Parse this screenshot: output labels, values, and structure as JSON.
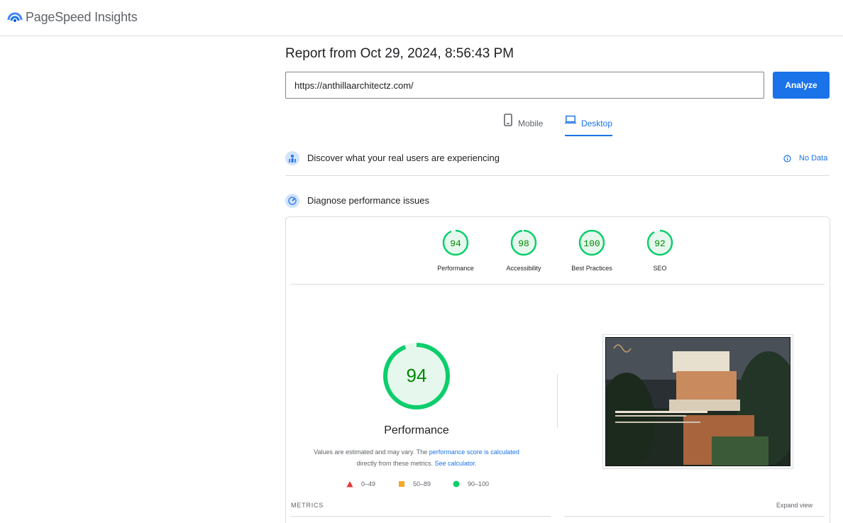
{
  "app": {
    "brand": "PageSpeed Insights"
  },
  "report": {
    "title": "Report from Oct 29, 2024, 8:56:43 PM"
  },
  "url_input": {
    "value": "https://anthillaarchitectz.com/"
  },
  "analyze_label": "Analyze",
  "tabs": [
    {
      "label": "Mobile",
      "icon": "phone-icon",
      "selected": false
    },
    {
      "label": "Desktop",
      "icon": "laptop-icon",
      "selected": true
    }
  ],
  "sections": {
    "real_users": {
      "title": "Discover what your real users are experiencing",
      "icon": "people-icon",
      "status": "No Data"
    },
    "diagnose": {
      "title": "Diagnose performance issues",
      "icon": "gauge-icon"
    }
  },
  "scores": [
    {
      "label": "Performance",
      "value": 94
    },
    {
      "label": "Accessibility",
      "value": 98
    },
    {
      "label": "Best Practices",
      "value": 100
    },
    {
      "label": "SEO",
      "value": 92
    }
  ],
  "performance": {
    "score": 94,
    "label": "Performance",
    "desc_prefix": "Values are estimated and may vary. The",
    "desc_link1": "performance score is calculated",
    "desc_middle": "directly from these metrics.",
    "desc_link2": "See calculator."
  },
  "legend": [
    {
      "range": "0–49",
      "shape": "triangle",
      "color": "#e53935"
    },
    {
      "range": "50–89",
      "shape": "square",
      "color": "#f9a825"
    },
    {
      "range": "90–100",
      "shape": "circle",
      "color": "#0cce6b"
    }
  ],
  "metrics_label": "METRICS",
  "expand_label": "Expand view",
  "colors": {
    "pass": "#0cce6b",
    "pass_text": "#008800",
    "pass_fill": "#e6f8ee",
    "accent": "#1a73e8"
  }
}
